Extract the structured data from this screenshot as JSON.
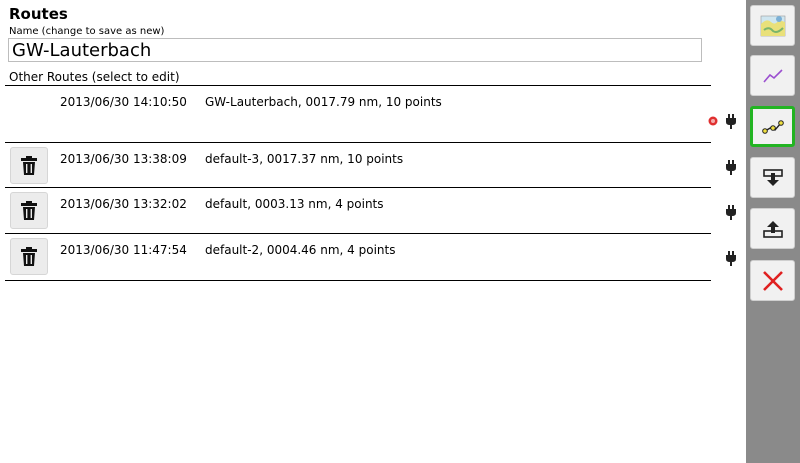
{
  "header": {
    "title": "Routes",
    "name_label": "Name (change to save as new)",
    "name_value": "GW-Lauterbach",
    "other_label": "Other Routes (select to edit)"
  },
  "routes": [
    {
      "date": "2013/06/30 14:10:50",
      "desc": "GW-Lauterbach, 0017.79 nm, 10 points",
      "active": true
    },
    {
      "date": "2013/06/30 13:38:09",
      "desc": "default-3, 0017.37 nm, 10 points",
      "active": false
    },
    {
      "date": "2013/06/30 13:32:02",
      "desc": "default, 0003.13 nm, 4 points",
      "active": false
    },
    {
      "date": "2013/06/30 11:47:54",
      "desc": "default-2, 0004.46 nm, 4 points",
      "active": false
    }
  ],
  "sidebar": {
    "buttons": [
      "map-icon",
      "track-icon",
      "route-icon",
      "import-icon",
      "export-icon",
      "close-icon"
    ],
    "active": "route-icon"
  },
  "colors": {
    "active_border": "#22b422",
    "sidebar_bg": "#8a8a8a",
    "close_red": "#e02020",
    "active_dot": "#e03030"
  }
}
